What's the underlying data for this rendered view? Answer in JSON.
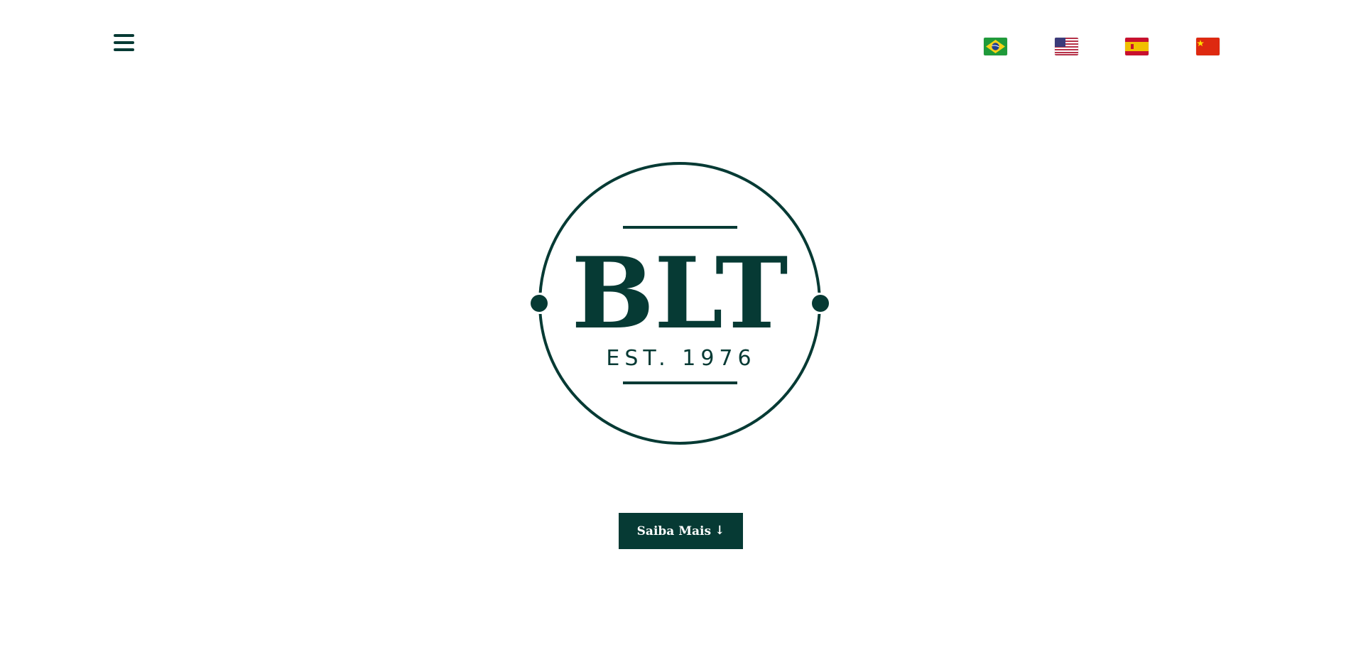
{
  "header": {
    "menu_icon": "hamburger-menu-icon",
    "languages": [
      {
        "code": "pt-BR",
        "icon": "brazil-flag-icon"
      },
      {
        "code": "en-US",
        "icon": "usa-flag-icon"
      },
      {
        "code": "es",
        "icon": "spain-flag-icon"
      },
      {
        "code": "zh",
        "icon": "china-flag-icon"
      }
    ]
  },
  "hero": {
    "logo": {
      "wordmark": "BLT",
      "tagline": "EST. 1976"
    },
    "cta": {
      "label": "Saiba Mais",
      "icon": "arrow-down-icon"
    }
  },
  "colors": {
    "brand": "#063a34",
    "background": "#ffffff"
  }
}
